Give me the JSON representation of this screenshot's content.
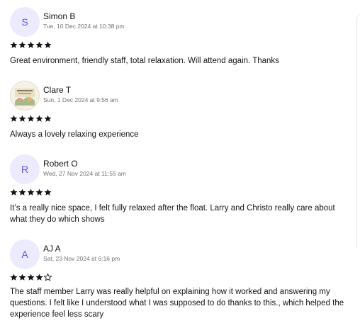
{
  "reviews": [
    {
      "avatar_letter": "S",
      "avatar_type": "letter",
      "name": "Simon B",
      "date": "Tue, 10 Dec 2024 at 10:38 pm",
      "rating": 5,
      "max_rating": 5,
      "text": "Great environment, friendly staff, total relaxation. Will attend again. Thanks"
    },
    {
      "avatar_letter": "",
      "avatar_type": "image",
      "name": "Clare T",
      "date": "Sun, 1 Dec 2024 at 9:56 am",
      "rating": 5,
      "max_rating": 5,
      "text": "Always a lovely relaxing experience"
    },
    {
      "avatar_letter": "R",
      "avatar_type": "letter",
      "name": "Robert O",
      "date": "Wed, 27 Nov 2024 at 11:55 am",
      "rating": 5,
      "max_rating": 5,
      "text": "It’s a really nice space, I felt fully relaxed after the float. Larry and Christo really care about what they do which shows"
    },
    {
      "avatar_letter": "A",
      "avatar_type": "letter",
      "name": "AJ A",
      "date": "Sat, 23 Nov 2024 at 6:16 pm",
      "rating": 4,
      "max_rating": 5,
      "text": "The staff member Larry was really helpful on explaining how it worked and answering my questions. I felt like I understood what I was supposed to do thanks to this., which helped the experience feel less scary"
    }
  ],
  "colors": {
    "avatar_bg": "#eceafd",
    "avatar_letter": "#6b52e0",
    "star_filled": "#141414",
    "date_text": "#737373"
  },
  "icons": {
    "star_filled": "star-icon",
    "star_empty": "star-outline-icon"
  }
}
